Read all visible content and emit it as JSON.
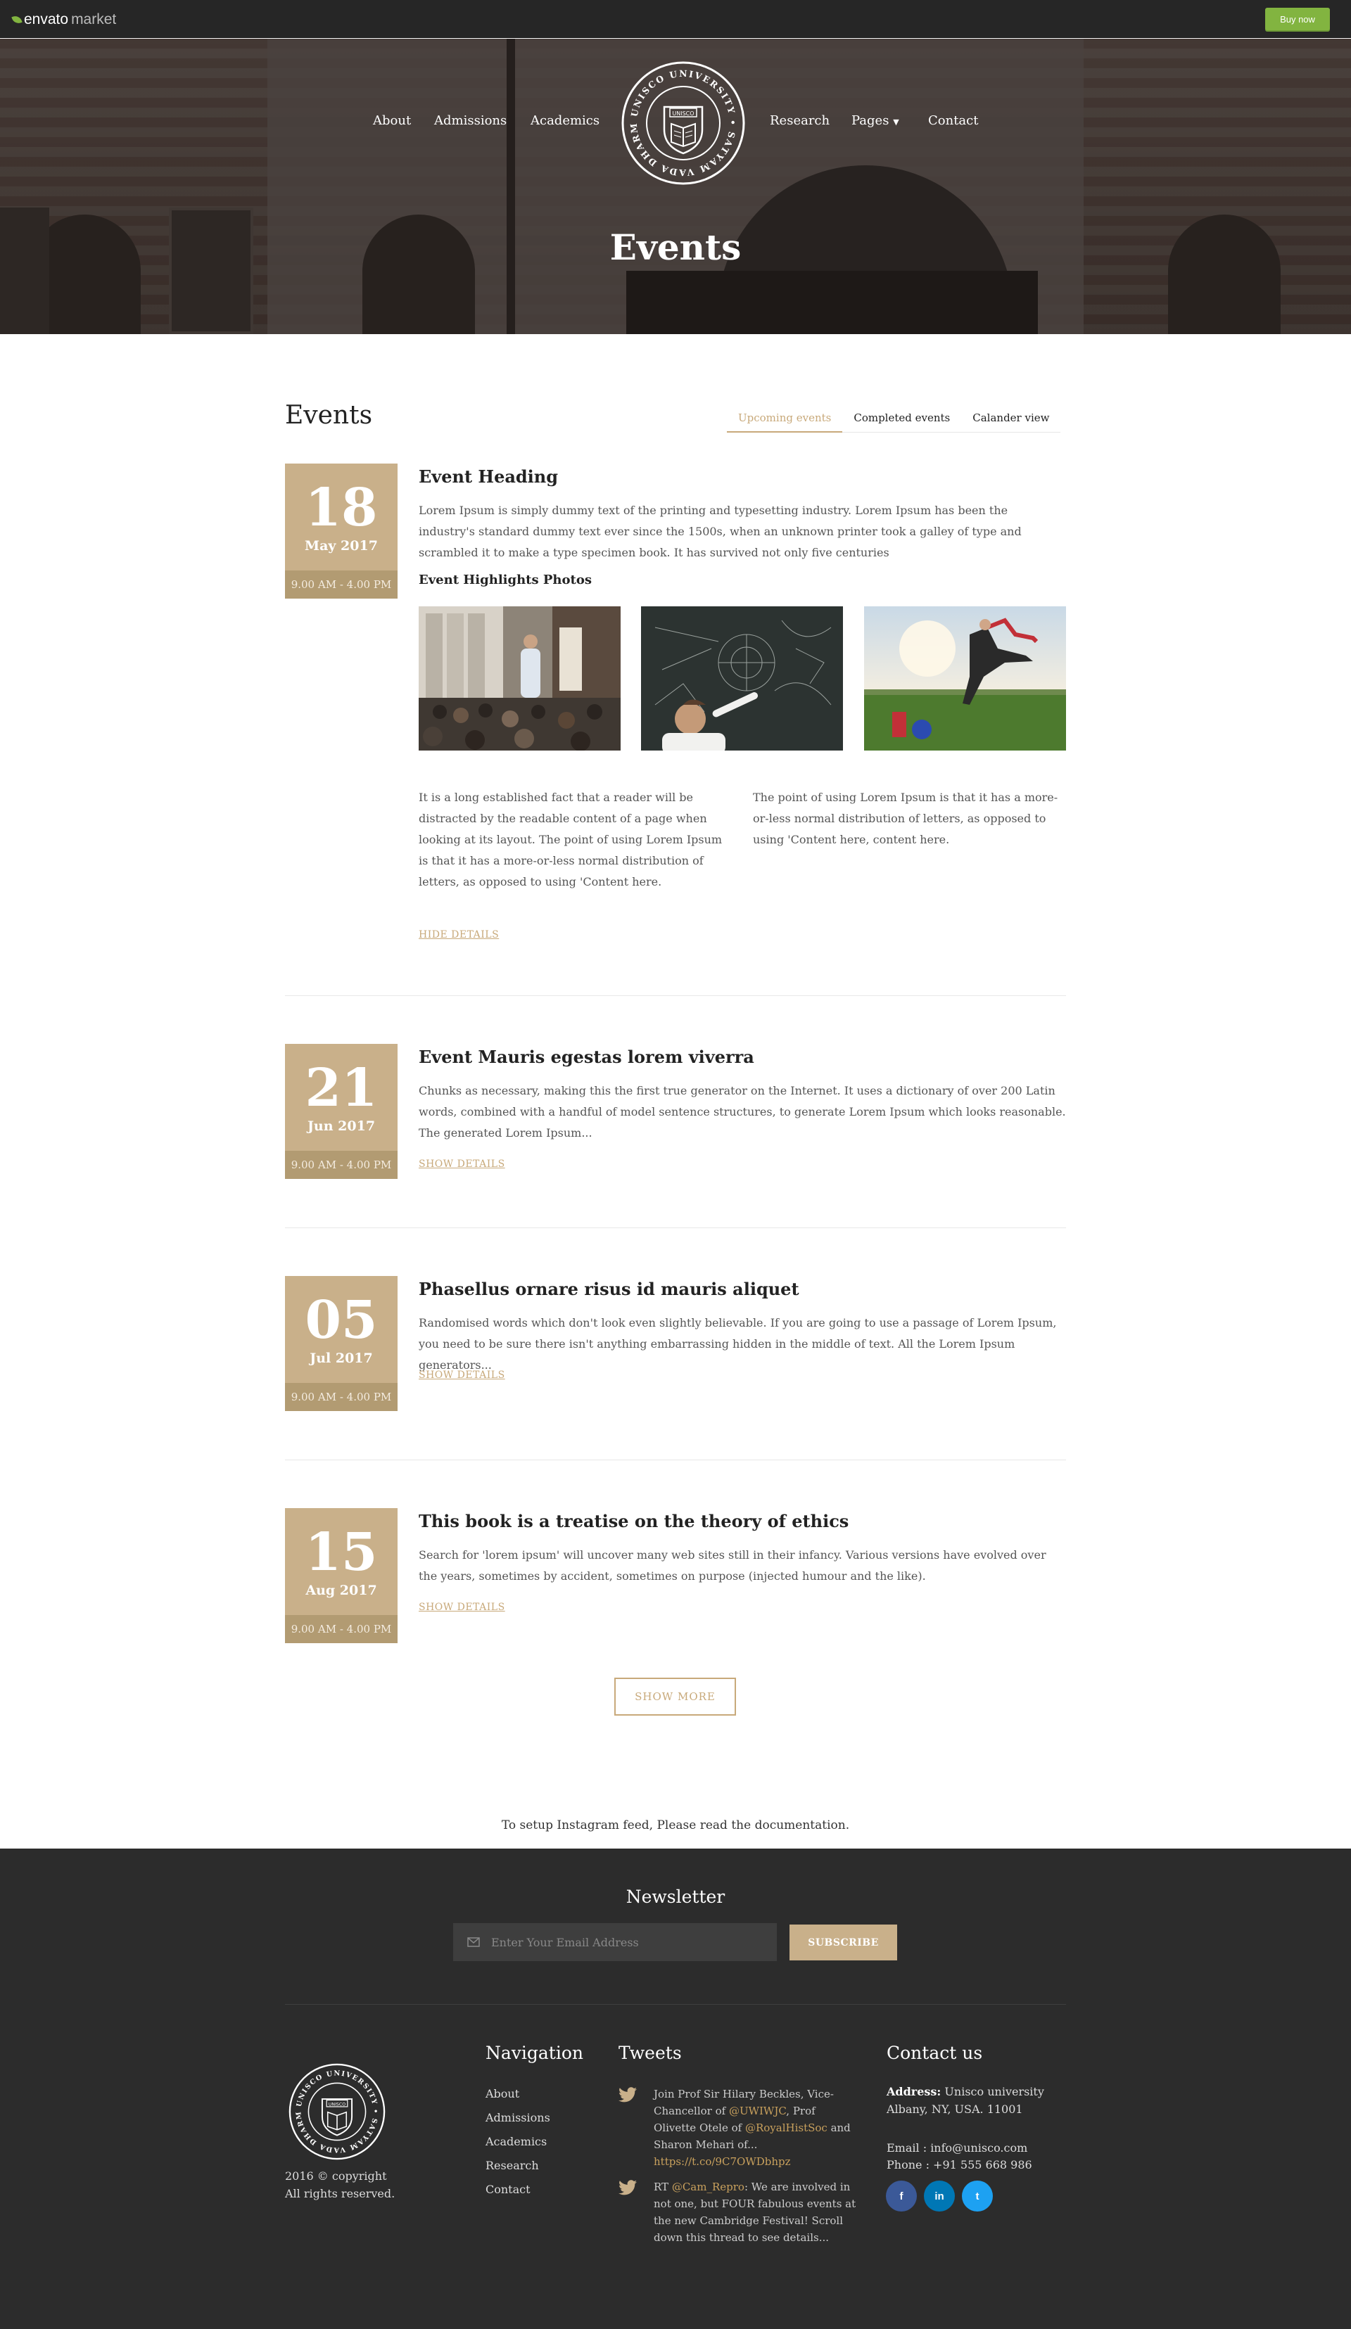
{
  "topbar": {
    "logo_main": "envato",
    "logo_sub": "market",
    "buy_label": "Buy now"
  },
  "nav": {
    "left": [
      "About",
      "Admissions",
      "Academics"
    ],
    "right": [
      "Research",
      "Pages",
      "Contact"
    ],
    "seal_ring_text": "UNISCO UNIVERSITY • SATYAM VADA DHARMAM CHARA •",
    "seal_banner": "UNISCO"
  },
  "hero": {
    "title": "Events"
  },
  "events_section": {
    "title": "Events",
    "tabs": [
      "Upcoming events",
      "Completed events",
      "Calander view"
    ]
  },
  "events": [
    {
      "day": "18",
      "month": "May 2017",
      "time": "9.00 AM - 4.00 PM",
      "title": "Event Heading",
      "description": "Lorem Ipsum is simply dummy text of the printing and typesetting industry. Lorem Ipsum has been the industry's standard dummy text ever since the 1500s, when an unknown printer took a galley of type and scrambled it to make a type specimen book. It has survived not only five centuries",
      "highlights_title": "Event Highlights Photos",
      "col1": "It is a long established fact that a reader will be distracted by the readable content of a page when looking at its layout. The point of using Lorem Ipsum is that it has a more-or-less normal distribution of letters, as opposed to using 'Content here.",
      "col2": "The point of using Lorem Ipsum is that it has a more-or-less normal distribution of letters, as opposed to using 'Content here, content here.",
      "link": "HIDE DETAILS"
    },
    {
      "day": "21",
      "month": "Jun 2017",
      "time": "9.00 AM - 4.00 PM",
      "title": "Event Mauris egestas lorem viverra",
      "description": "Chunks as necessary, making this the first true generator on the Internet. It uses a dictionary of over 200 Latin words, combined with a handful of model sentence structures, to generate Lorem Ipsum which looks reasonable. The generated Lorem Ipsum...",
      "link": "SHOW DETAILS"
    },
    {
      "day": "05",
      "month": "Jul 2017",
      "time": "9.00 AM - 4.00 PM",
      "title": "Phasellus ornare risus id mauris aliquet",
      "description": "Randomised words which don't look even slightly believable. If you are going to use a passage of Lorem Ipsum, you need to be sure there isn't anything embarrassing hidden in the middle of text. All the Lorem Ipsum generators...",
      "link": "SHOW DETAILS"
    },
    {
      "day": "15",
      "month": "Aug 2017",
      "time": "9.00 AM - 4.00 PM",
      "title": "This book is a treatise on the theory of ethics",
      "description": "Search for 'lorem ipsum' will uncover many web sites still in their infancy. Various versions have evolved over the years, sometimes by accident, sometimes on purpose (injected humour and the like).",
      "link": "SHOW DETAILS"
    }
  ],
  "show_more": "SHOW MORE",
  "instagram_note": "To setup Instagram feed, Please read the documentation.",
  "footer": {
    "newsletter_title": "Newsletter",
    "email_placeholder": "Enter Your Email Address",
    "subscribe": "SUBSCRIBE",
    "copyright": "2016 © copyright",
    "rights": "All rights reserved.",
    "nav_title": "Navigation",
    "nav_items": [
      "About",
      "Admissions",
      "Academics",
      "Research",
      "Contact"
    ],
    "tweets_title": "Tweets",
    "tweet1": {
      "a": "Join Prof Sir Hilary Beckles, Vice-Chancellor of ",
      "h1": "@UWIWJC",
      "b": ", Prof Olivette Otele of ",
      "h2": "@RoyalHistSoc",
      "c": " and Sharon Mehari of... ",
      "h3": "https://t.co/9C7OWDbhpz"
    },
    "tweet2": {
      "a": "RT ",
      "h1": "@Cam_Repro",
      "b": ": We are involved in not one, but FOUR fabulous events at the new Cambridge Festival! Scroll down this thread to see details..."
    },
    "contact_title": "Contact us",
    "address_label": "Address:",
    "address": " Unisco university Albany, NY, USA. 11001",
    "email": "Email : info@unisco.com",
    "phone": "Phone : +91 555 668 986",
    "social": [
      "f",
      "in",
      "t"
    ]
  },
  "colors": {
    "accent": "#c9b08a",
    "footer_bg": "#2c2c2c",
    "envato_green": "#82b440"
  }
}
